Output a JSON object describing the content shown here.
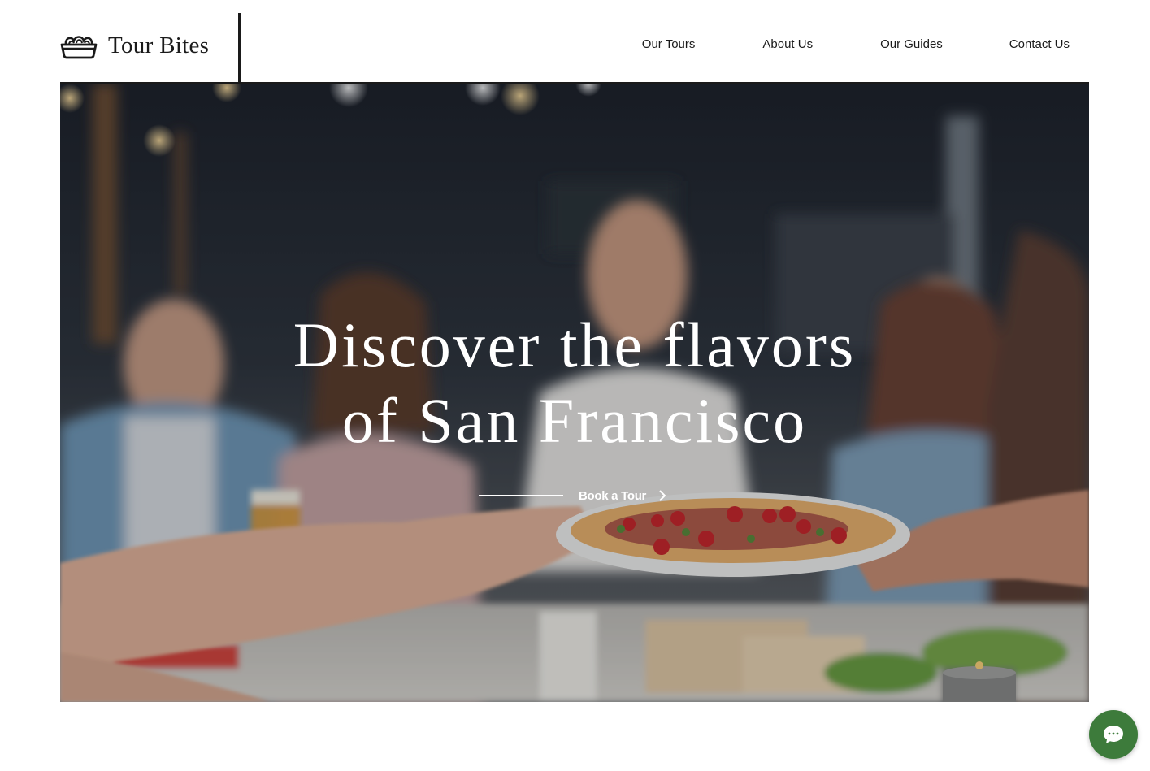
{
  "brand": {
    "name": "Tour Bites",
    "icon": "bread-basket-icon"
  },
  "nav": {
    "items": [
      {
        "label": "Our Tours"
      },
      {
        "label": "About Us"
      },
      {
        "label": "Our Guides"
      },
      {
        "label": "Contact Us"
      }
    ]
  },
  "hero": {
    "title_line1": "Discover the flavors",
    "title_line2": "of San Francisco",
    "cta_label": "Book a Tour",
    "cta_icon": "chevron-right-icon",
    "image": "friends-sharing-food-at-table"
  },
  "chat": {
    "icon": "chat-bubble-icon",
    "color": "#3d7b3b"
  },
  "colors": {
    "text": "#1a1a1a",
    "hero_text": "#ffffff",
    "accent": "#3d7b3b"
  }
}
